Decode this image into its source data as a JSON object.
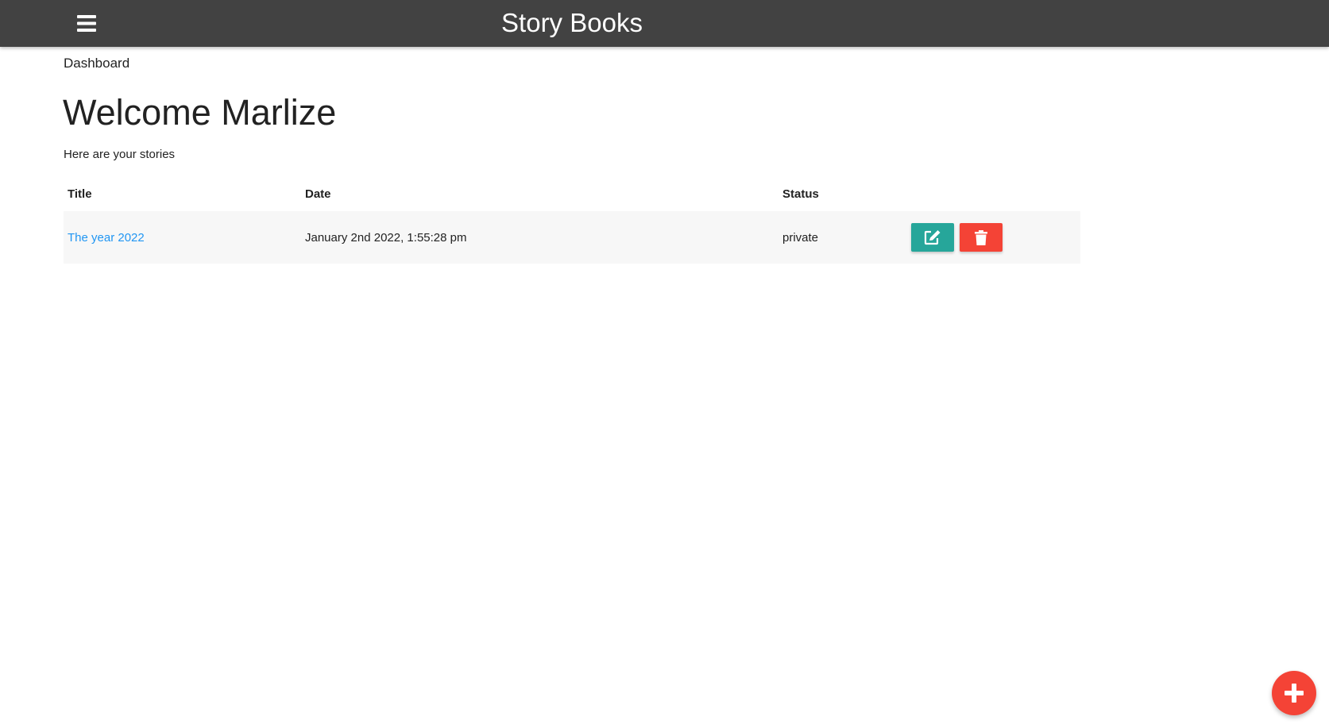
{
  "navbar": {
    "brand": "Story Books",
    "background": "#424242",
    "menu_icon": "hamburger-menu-icon"
  },
  "breadcrumb": "Dashboard",
  "main": {
    "title": "Welcome Marlize",
    "subtitle": "Here are your stories"
  },
  "table": {
    "headers": {
      "title": "Title",
      "date": "Date",
      "status": "Status"
    },
    "rows": [
      {
        "title": "The year 2022",
        "date": "January 2nd 2022, 1:55:28 pm",
        "status": "private",
        "edit_icon": "edit-icon",
        "delete_icon": "trash-icon"
      }
    ]
  },
  "fab": {
    "icon": "plus-icon",
    "color": "#f44336"
  },
  "colors": {
    "link": "#2196f3",
    "edit": "#26a69a",
    "delete": "#f44336"
  }
}
